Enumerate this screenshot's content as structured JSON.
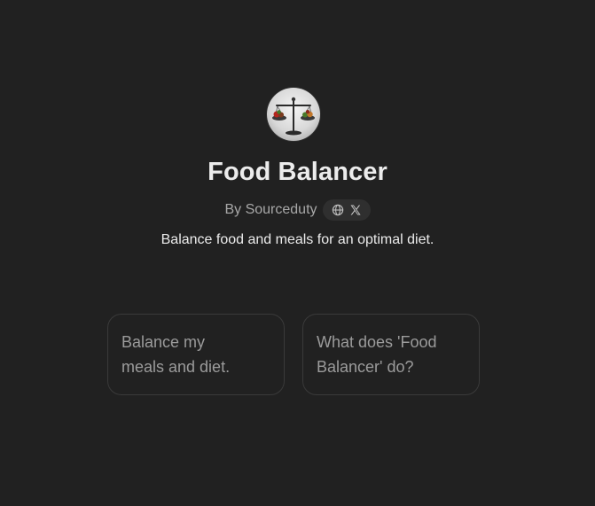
{
  "gpt": {
    "name": "Food Balancer",
    "byline": "By Sourceduty",
    "description": "Balance food and meals for an optimal diet."
  },
  "avatar": {
    "icon": "scale-icon"
  },
  "social": {
    "icons": [
      "globe-icon",
      "x-logo-icon"
    ]
  },
  "starters": [
    {
      "line1": "Balance my",
      "line2": "meals and diet."
    },
    {
      "line1": "What does 'Food",
      "line2": "Balancer' do?"
    }
  ],
  "colors": {
    "background": "#212121",
    "title": "#ececec",
    "muted": "#a8a8a8",
    "card_border": "#3a3a3a",
    "pill": "#2f2f2f"
  }
}
